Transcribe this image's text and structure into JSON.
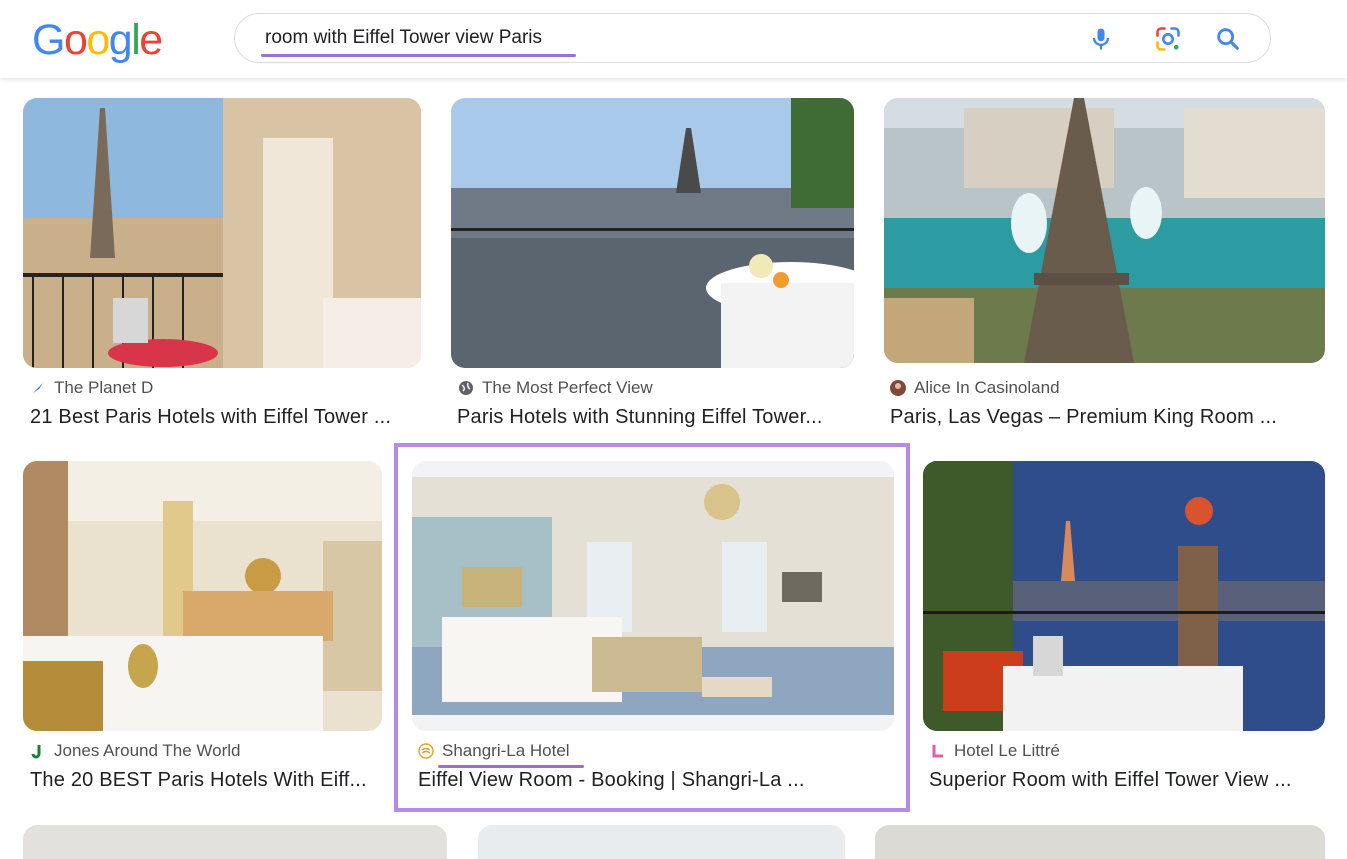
{
  "header": {
    "logo_letters": [
      {
        "ch": "G",
        "color": "#4285F4"
      },
      {
        "ch": "o",
        "color": "#EA4335"
      },
      {
        "ch": "o",
        "color": "#FBBC05"
      },
      {
        "ch": "g",
        "color": "#4285F4"
      },
      {
        "ch": "l",
        "color": "#34A853"
      },
      {
        "ch": "e",
        "color": "#EA4335"
      }
    ],
    "query": "room with Eiffel Tower view Paris",
    "icons": [
      "mic-icon",
      "google-lens-icon",
      "search-icon"
    ]
  },
  "results": [
    {
      "source": "The Planet D",
      "title": "21 Best Paris Hotels with Eiffel Tower ...",
      "favicon": "planet-d-icon"
    },
    {
      "source": "The Most Perfect View",
      "title": "Paris Hotels with Stunning Eiffel Tower...",
      "favicon": "globe-icon"
    },
    {
      "source": "Alice In Casinoland",
      "title": "Paris, Las Vegas – Premium King Room ...",
      "favicon": "avatar-icon"
    },
    {
      "source": "Jones Around The World",
      "title": "The 20 BEST Paris Hotels With Eiff...",
      "favicon": "jones-icon"
    },
    {
      "source": "Shangri-La Hotel",
      "title": "Eiffel View Room - Booking | Shangri-La ...",
      "favicon": "shangri-la-icon"
    },
    {
      "source": "Hotel Le Littré",
      "title": "Superior Room with Eiffel Tower View ...",
      "favicon": "le-littre-icon"
    }
  ],
  "colors": {
    "highlight": "#b68be8",
    "underline": "#9b6fd6"
  }
}
